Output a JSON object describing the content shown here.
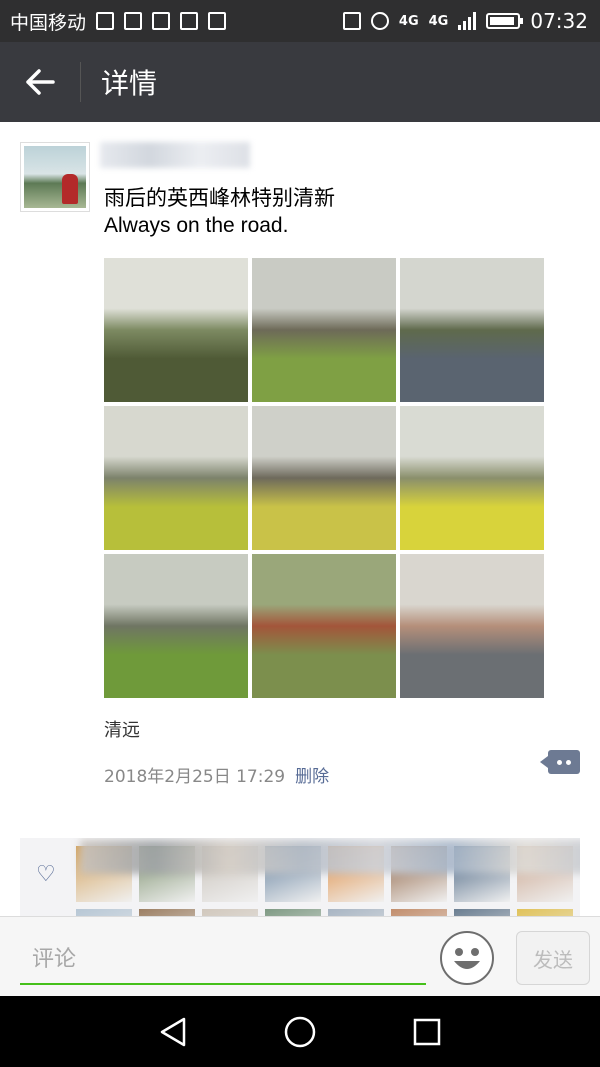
{
  "status_bar": {
    "carrier": "中国移动",
    "network": "4G",
    "network2": "4G",
    "time": "07:32"
  },
  "header": {
    "title": "详情",
    "back_icon": "back-arrow-icon"
  },
  "post": {
    "text_line1": "雨后的英西峰林特别清新",
    "text_line2": "Always on the road.",
    "photos": [
      {
        "name": "photo-stone-bridge",
        "colors": [
          "#dfe0d8",
          "#7d8a62",
          "#4f5a36"
        ]
      },
      {
        "name": "photo-karst-field",
        "colors": [
          "#c9cbc4",
          "#6d6a58",
          "#7fa044"
        ]
      },
      {
        "name": "photo-karst-reflection",
        "colors": [
          "#d4d6cf",
          "#5f6a4c",
          "#5a6470"
        ]
      },
      {
        "name": "photo-rapeseed-hills",
        "colors": [
          "#d7d8cf",
          "#7c826b",
          "#b7bf3a"
        ]
      },
      {
        "name": "photo-woman-field",
        "colors": [
          "#cfd0c9",
          "#6e6a5c",
          "#c9c248"
        ]
      },
      {
        "name": "photo-rapeseed-closeup",
        "colors": [
          "#d9dbd3",
          "#8a8f6c",
          "#d8d33b"
        ]
      },
      {
        "name": "photo-village-path",
        "colors": [
          "#c7cbc1",
          "#6f7563",
          "#6f9a3a"
        ]
      },
      {
        "name": "photo-cow",
        "colors": [
          "#9aa77a",
          "#a3553a",
          "#7c8f4d"
        ]
      },
      {
        "name": "photo-village-water",
        "colors": [
          "#d9d6cf",
          "#b58f7a",
          "#6b6f73"
        ]
      }
    ],
    "location": "清远",
    "timestamp": "2018年2月25日 17:29",
    "delete_label": "删除"
  },
  "likes": {
    "avatars": [
      "#d4a25b",
      "#7a8f6a",
      "#c7c0b7",
      "#5f7d9c",
      "#e08a3c",
      "#8b5c3a",
      "#3d5a7a",
      "#c9a28a",
      "#b7c7d5",
      "#9c7f63",
      "#d1c8bd",
      "#7f9a84",
      "#a8b5c3",
      "#c28e6d",
      "#6b7e91",
      "#e0c25a"
    ]
  },
  "comment_bar": {
    "placeholder": "评论",
    "send_label": "发送"
  },
  "colors": {
    "status_bg": "#2f2f30",
    "title_bg": "#393a3f",
    "link": "#576b95",
    "input_underline": "#45c01a"
  }
}
